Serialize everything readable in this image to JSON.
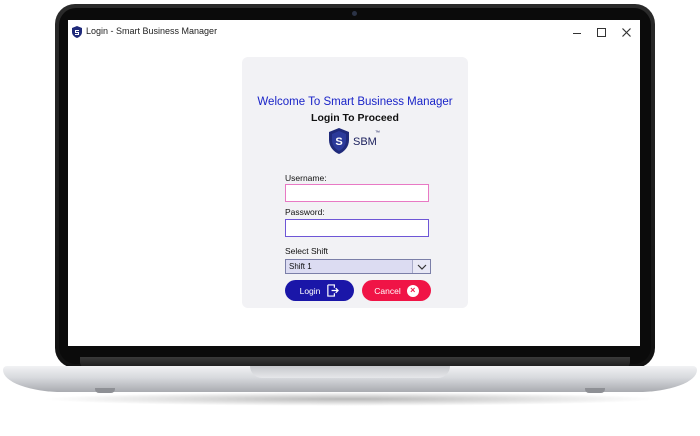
{
  "window": {
    "title": "Login - Smart Business Manager",
    "icons": [
      "shield-logo-icon",
      "minimize-icon",
      "maximize-icon",
      "close-icon"
    ]
  },
  "login": {
    "welcome": "Welcome To Smart Business Manager",
    "subtitle": "Login To Proceed",
    "logo_letter": "S",
    "logo_text": "SBM",
    "logo_tm": "™",
    "username_label": "Username:",
    "username_value": "",
    "password_label": "Password:",
    "password_value": "",
    "shift_label": "Select Shift",
    "shift_selected": "Shift 1",
    "login_button": "Login",
    "cancel_button": "Cancel",
    "cancel_icon_glyph": "×"
  },
  "colors": {
    "welcome_text": "#1a24c8",
    "login_button": "#1a16a8",
    "cancel_button": "#f01446",
    "username_border": "#e879c4",
    "password_border": "#6e56d6",
    "logo_shield": "#1f2a7a"
  }
}
